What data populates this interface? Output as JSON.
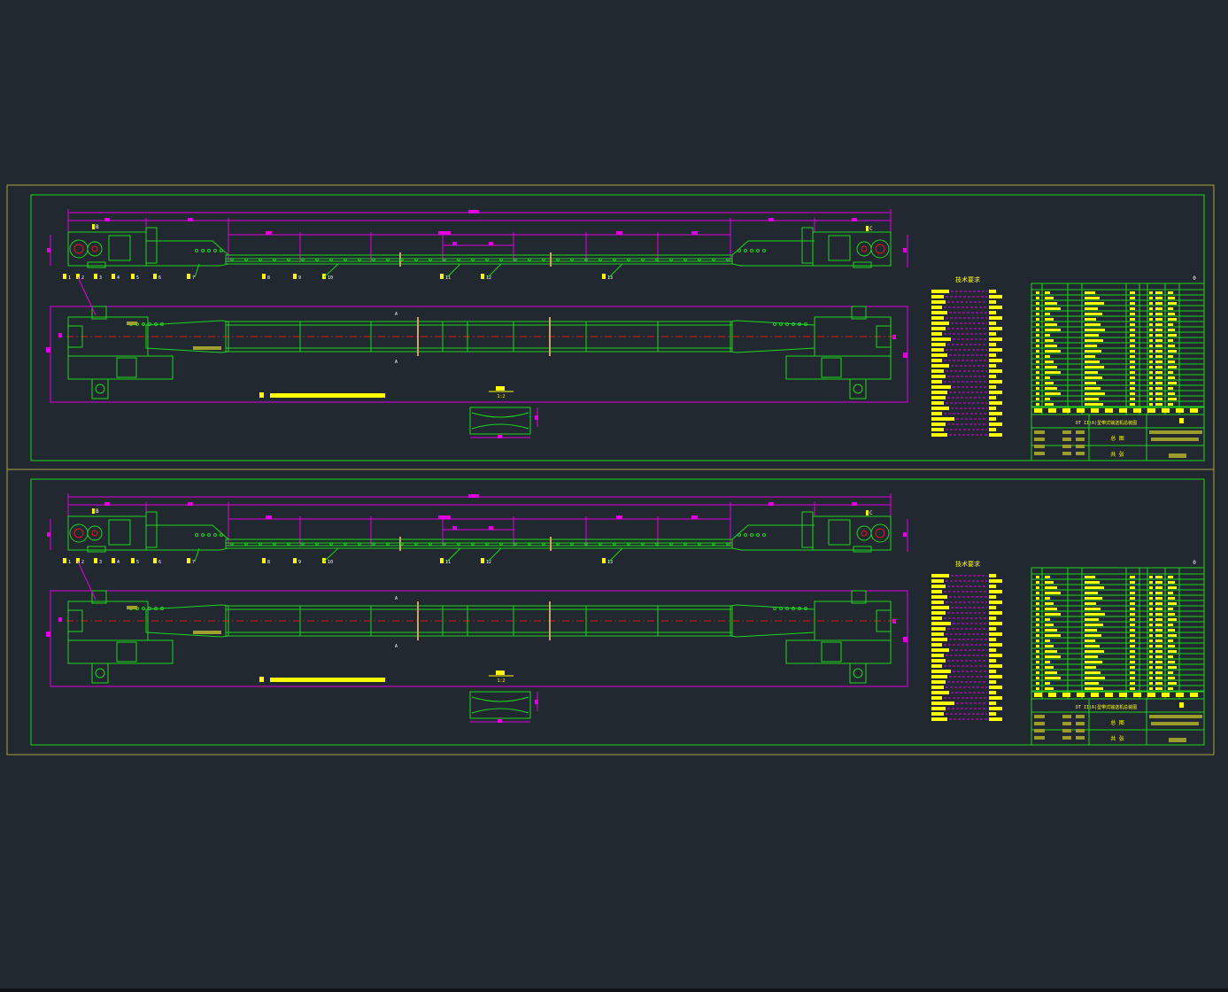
{
  "colors": {
    "background": "#212830",
    "frame": "#a8a63a",
    "drawing": "#1ed41e",
    "dimension": "#e000e0",
    "centerline": "#e01818",
    "label": "#ffff00",
    "text": "#ffffff"
  },
  "sheets": [
    {
      "position_labels": [
        "1",
        "2",
        "3",
        "4",
        "5",
        "6",
        "7",
        "8",
        "9",
        "10",
        "11",
        "12",
        "13",
        "14",
        "15",
        "16",
        "17"
      ],
      "section_marks": [
        "A",
        "A",
        "B",
        "C"
      ],
      "detail_scale": "1:2",
      "notes_title": "技术要求",
      "title_block": {
        "drawing_title": "DT II(A)型带式输送机总装图",
        "view_label": "总 图",
        "footer_label": "共 张",
        "revision": "0"
      }
    },
    {
      "position_labels": [
        "1",
        "2",
        "3",
        "4",
        "5",
        "6",
        "7",
        "8",
        "9",
        "10",
        "11",
        "12",
        "13",
        "14",
        "15",
        "16",
        "17"
      ],
      "section_marks": [
        "A",
        "A",
        "B",
        "C"
      ],
      "detail_scale": "1:2",
      "notes_title": "技术要求",
      "title_block": {
        "drawing_title": "DT II(A)型带式输送机总装图",
        "view_label": "总 图",
        "footer_label": "共 张",
        "revision": "0"
      }
    }
  ]
}
